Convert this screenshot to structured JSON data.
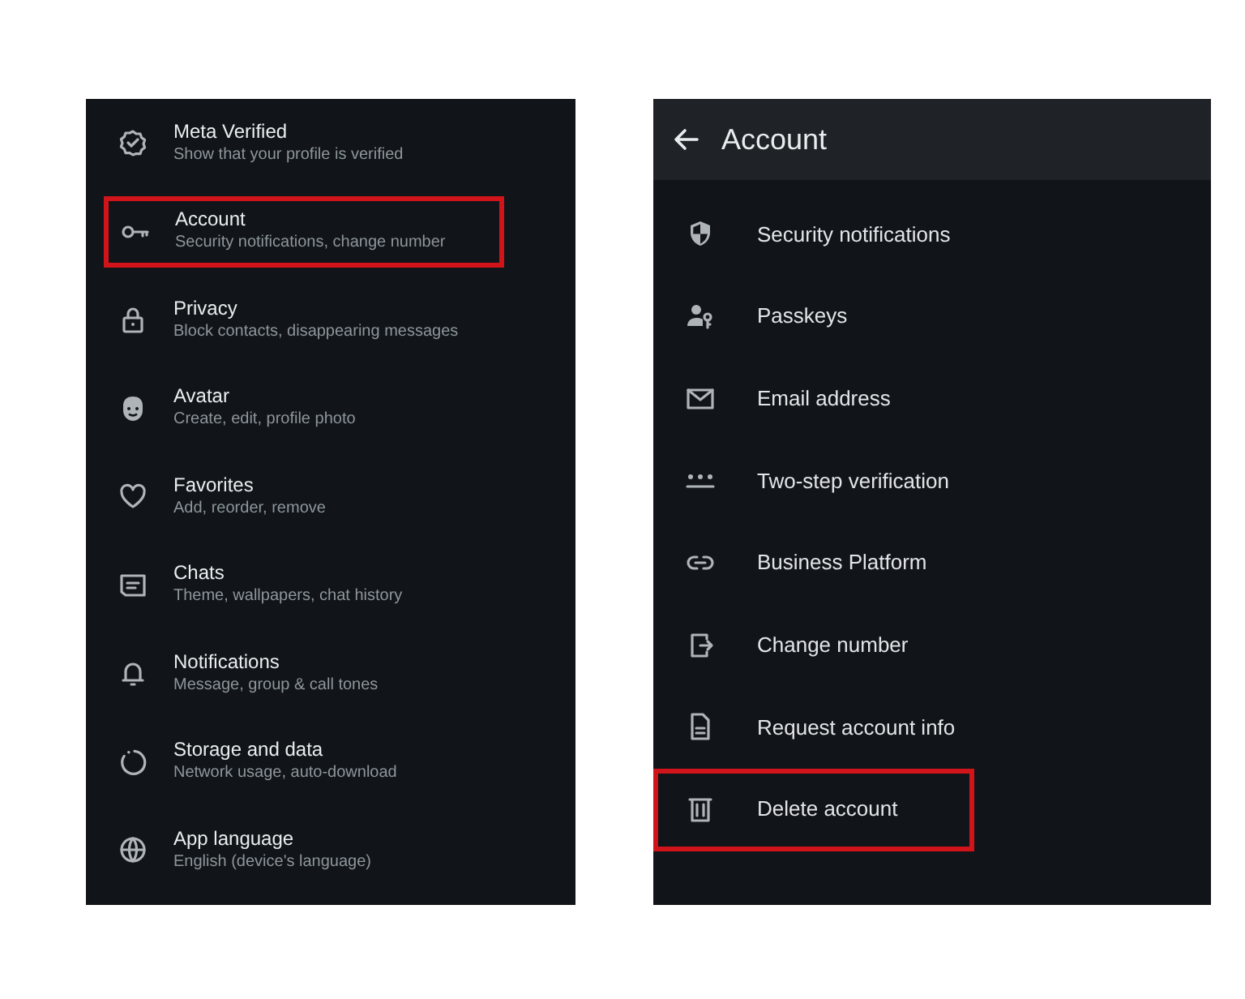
{
  "settings_list": [
    {
      "title": "Meta Verified",
      "subtitle": "Show that your profile is verified",
      "highlighted": false
    },
    {
      "title": "Account",
      "subtitle": "Security notifications, change number",
      "highlighted": true
    },
    {
      "title": "Privacy",
      "subtitle": "Block contacts, disappearing messages",
      "highlighted": false
    },
    {
      "title": "Avatar",
      "subtitle": "Create, edit, profile photo",
      "highlighted": false
    },
    {
      "title": "Favorites",
      "subtitle": "Add, reorder, remove",
      "highlighted": false
    },
    {
      "title": "Chats",
      "subtitle": "Theme, wallpapers, chat history",
      "highlighted": false
    },
    {
      "title": "Notifications",
      "subtitle": "Message, group & call tones",
      "highlighted": false
    },
    {
      "title": "Storage and data",
      "subtitle": "Network usage, auto-download",
      "highlighted": false
    },
    {
      "title": "App language",
      "subtitle": "English (device's language)",
      "highlighted": false
    }
  ],
  "account_screen": {
    "title": "Account",
    "items": [
      {
        "label": "Security notifications",
        "highlighted": false
      },
      {
        "label": "Passkeys",
        "highlighted": false
      },
      {
        "label": "Email address",
        "highlighted": false
      },
      {
        "label": "Two-step verification",
        "highlighted": false
      },
      {
        "label": "Business Platform",
        "highlighted": false
      },
      {
        "label": "Change number",
        "highlighted": false
      },
      {
        "label": "Request account info",
        "highlighted": false
      },
      {
        "label": "Delete account",
        "highlighted": true
      }
    ]
  }
}
